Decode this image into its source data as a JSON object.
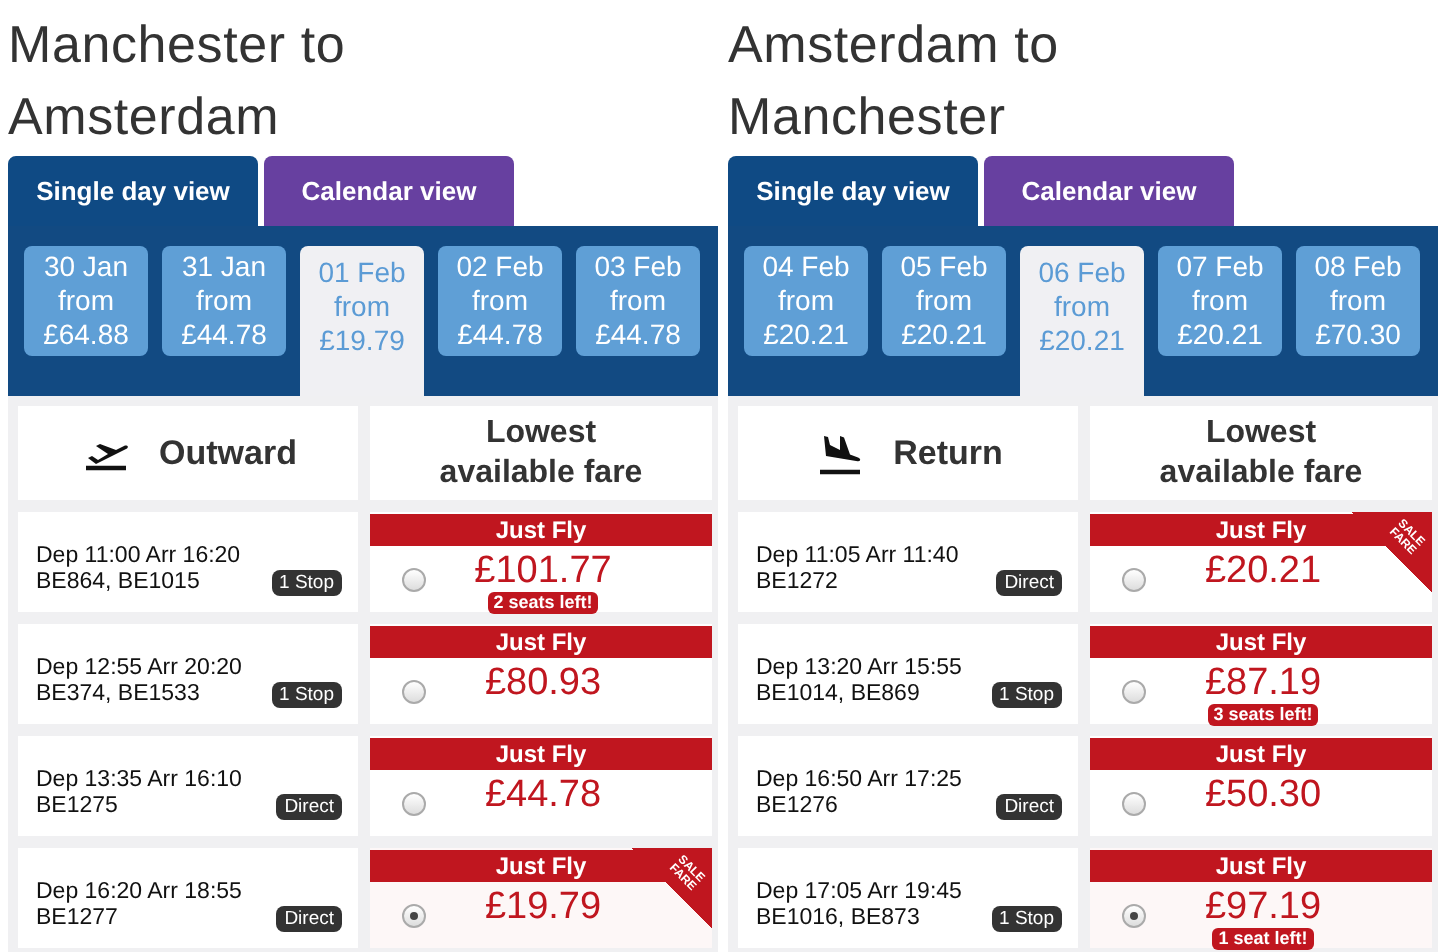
{
  "routes": [
    {
      "title": "Manchester to Amsterdam",
      "tabs": [
        {
          "label": "Single day view",
          "selected": true
        },
        {
          "label": "Calendar view",
          "selected": false
        }
      ],
      "dates": [
        {
          "date": "30 Jan",
          "from": "from",
          "price": "£64.88",
          "selected": false
        },
        {
          "date": "31 Jan",
          "from": "from",
          "price": "£44.78",
          "selected": false
        },
        {
          "date": "01 Feb",
          "from": "from",
          "price": "£19.79",
          "selected": true
        },
        {
          "date": "02 Feb",
          "from": "from",
          "price": "£44.78",
          "selected": false
        },
        {
          "date": "03 Feb",
          "from": "from",
          "price": "£44.78",
          "selected": false
        }
      ],
      "table": {
        "kind": "outward",
        "heading": "Outward",
        "fare_heading": "Lowest available fare",
        "flights": [
          {
            "times": "Dep 11:00 Arr 16:20",
            "numbers": "BE864, BE1015",
            "stops": "1 Stop",
            "fare_label": "Just Fly",
            "price": "£101.77",
            "seats_left": "2 seats left!",
            "selected": false
          },
          {
            "times": "Dep 12:55 Arr 20:20",
            "numbers": "BE374, BE1533",
            "stops": "1 Stop",
            "fare_label": "Just Fly",
            "price": "£80.93",
            "selected": false
          },
          {
            "times": "Dep 13:35 Arr 16:10",
            "numbers": "BE1275",
            "stops": "Direct",
            "fare_label": "Just Fly",
            "price": "£44.78",
            "selected": false
          },
          {
            "times": "Dep 16:20 Arr 18:55",
            "numbers": "BE1277",
            "stops": "Direct",
            "fare_label": "Just Fly",
            "price": "£19.79",
            "sale_badge": "SALE FARE",
            "selected": true
          }
        ]
      }
    },
    {
      "title": "Amsterdam to Manchester",
      "tabs": [
        {
          "label": "Single day view",
          "selected": true
        },
        {
          "label": "Calendar view",
          "selected": false
        }
      ],
      "dates": [
        {
          "date": "04 Feb",
          "from": "from",
          "price": "£20.21",
          "selected": false
        },
        {
          "date": "05 Feb",
          "from": "from",
          "price": "£20.21",
          "selected": false
        },
        {
          "date": "06 Feb",
          "from": "from",
          "price": "£20.21",
          "selected": true
        },
        {
          "date": "07 Feb",
          "from": "from",
          "price": "£20.21",
          "selected": false
        },
        {
          "date": "08 Feb",
          "from": "from",
          "price": "£70.30",
          "selected": false
        }
      ],
      "table": {
        "kind": "return",
        "heading": "Return",
        "fare_heading": "Lowest available fare",
        "flights": [
          {
            "times": "Dep 11:05 Arr 11:40",
            "numbers": "BE1272",
            "stops": "Direct",
            "fare_label": "Just Fly",
            "price": "£20.21",
            "sale_badge": "SALE FARE",
            "selected": false
          },
          {
            "times": "Dep 13:20 Arr 15:55",
            "numbers": "BE1014, BE869",
            "stops": "1 Stop",
            "fare_label": "Just Fly",
            "price": "£87.19",
            "seats_left": "3 seats left!",
            "selected": false
          },
          {
            "times": "Dep 16:50 Arr 17:25",
            "numbers": "BE1276",
            "stops": "Direct",
            "fare_label": "Just Fly",
            "price": "£50.30",
            "selected": false
          },
          {
            "times": "Dep 17:05 Arr 19:45",
            "numbers": "BE1016, BE873",
            "stops": "1 Stop",
            "fare_label": "Just Fly",
            "price": "£97.19",
            "seats_left": "1 seat left!",
            "selected": true
          }
        ]
      }
    }
  ]
}
